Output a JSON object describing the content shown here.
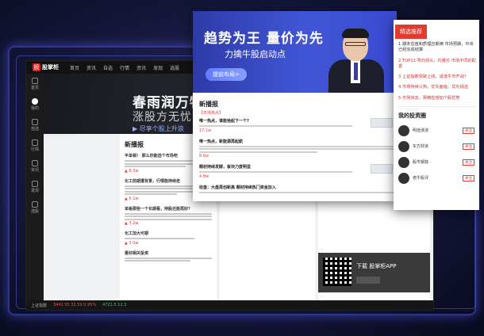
{
  "app": {
    "logo_text": "股掌柜",
    "logo_mark": "股",
    "menu": [
      "首页",
      "资讯",
      "自选",
      "行情",
      "资讯",
      "发现",
      "选股"
    ],
    "sidebar": [
      {
        "label": "首页",
        "icon": "home-icon"
      },
      {
        "label": "我的",
        "icon": "user-icon",
        "active": true
      },
      {
        "label": "自选",
        "icon": "star-icon"
      },
      {
        "label": "行情",
        "icon": "chart-icon"
      },
      {
        "label": "资讯",
        "icon": "news-icon"
      },
      {
        "label": "发现",
        "icon": "discover-icon"
      },
      {
        "label": "选股",
        "icon": "filter-icon"
      }
    ],
    "banner": {
      "title": "春雨润万物",
      "subtitle": "涨股方无忧",
      "bullet": "▶ 尽享个股上升浪"
    },
    "news_title": "新播报",
    "news_items": [
      {
        "title": "平单相！ 那么你能选个市场吧",
        "heat": "▲ 8.3w"
      },
      {
        "title": "化工前期遭背景，行情能持续走",
        "heat": "▲ 5.1w"
      },
      {
        "title": "单板那些一个长期看，持股还能再好？",
        "heat": "▲ 3.2w"
      },
      {
        "title": "化工加大可期",
        "heat": "▲ 3.0w"
      },
      {
        "title": "重材相关投资",
        "heat": ""
      }
    ],
    "qr_text": "下载 股掌柜APP",
    "status": {
      "label": "上证指数",
      "up": "3441.95  32.59  0.95%",
      "dn": "4721.5  12.3"
    }
  },
  "web": {
    "promo_title": "趋势为王 量价为先",
    "promo_sub": "力擒牛股启动点",
    "promo_button": "提前布局>",
    "news_title": "新播报",
    "tag": "【市场热点】",
    "items": [
      {
        "title": "唯一热点，谁能拾起下一个?",
        "heat": "17.1w"
      },
      {
        "title": "唯一热点，新能源再起航",
        "heat": "8.6w"
      },
      {
        "title": "题材持续发酵，板块力度明显",
        "heat": "4.8w"
      },
      {
        "title": "收盘：大盘再创新高 题材持续热门资金加入",
        "heat": ""
      }
    ]
  },
  "side": {
    "header": "精选推荐",
    "items": [
      "1 期末估值和质理应期满 市场预期，中央已经完成结算",
      "2 TOP11 导向领头，均量价 市场不同的配置",
      "3 上证指数突破上线，适逢牛市开战?",
      "4 市场持续火热，优先面临，优先挑选",
      "5 市场快去，那精控增加个股优势"
    ],
    "investors_title": "我的投资圈",
    "investors": [
      {
        "name": "明途涨涨",
        "action": "关注"
      },
      {
        "name": "东方财道",
        "action": "关注"
      },
      {
        "name": "股市钢铁",
        "action": "关注"
      },
      {
        "name": "老牛股评",
        "action": "关注"
      }
    ]
  }
}
